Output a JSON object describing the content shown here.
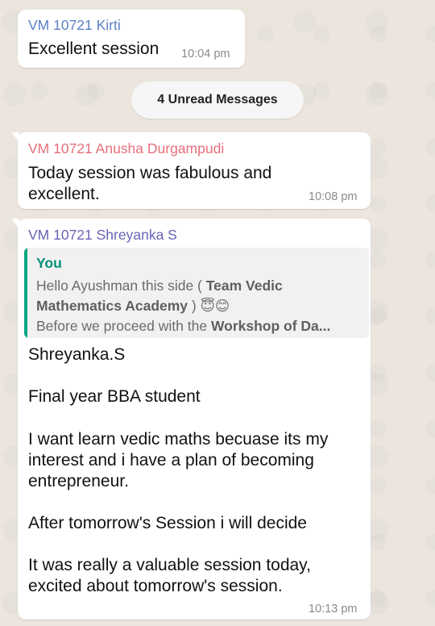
{
  "messages": [
    {
      "sender": "VM 10721 Kirti",
      "sender_color": "#5c7fc4",
      "lines": [
        "Excellent session"
      ],
      "time": "10:04 pm"
    },
    {
      "sender": "VM 10721 Anusha Durgampudi",
      "sender_color": "#e76f7a",
      "lines": [
        "Today session was fabulous and",
        "excellent."
      ],
      "time": "10:08 pm"
    },
    {
      "sender": "VM 10721 Shreyanka S",
      "sender_color": "#6a64b5",
      "quote": {
        "author": "You",
        "line1_prefix": "Hello Ayushman this side ( ",
        "line1_bold": "Team Vedic",
        "line2_bold": "Mathematics Academy",
        "line2_suffix": " ) 😇😊",
        "line3_prefix": "Before we proceed with the ",
        "line3_bold": "Workshop of Da..."
      },
      "lines": [
        "Shreyanka.S",
        "",
        "Final year BBA student",
        "",
        "I want learn vedic maths becuase its my",
        "interest and i have a plan of becoming",
        "entrepreneur.",
        "",
        "After tomorrow's Session i will decide",
        "",
        "It was really a valuable session today,",
        "excited about tomorrow's session."
      ],
      "time": "10:13 pm"
    }
  ],
  "unread_label": "4 Unread Messages",
  "colors": {
    "background": "#ebe5de",
    "bubble": "#ffffff",
    "quote_bar": "#06a884",
    "quote_author": "#06907a",
    "timestamp": "#8a8a8a"
  }
}
